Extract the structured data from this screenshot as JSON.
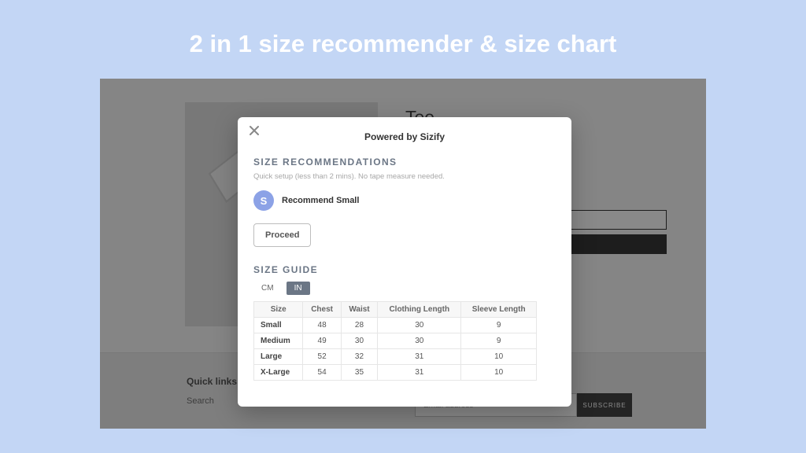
{
  "hero": {
    "title": "2 in 1 size recommender & size chart"
  },
  "product": {
    "title": "Tee"
  },
  "footer": {
    "quick_links_label": "Quick links",
    "search_label": "Search",
    "email_placeholder": "Email address",
    "subscribe_label": "SUBSCRIBE"
  },
  "modal": {
    "powered_by": "Powered by Sizify",
    "recommend_heading": "SIZE RECOMMENDATIONS",
    "recommend_sub": "Quick setup (less than 2 mins). No tape measure needed.",
    "badge_letter": "S",
    "recommend_text": "Recommend Small",
    "proceed_label": "Proceed",
    "guide_heading": "SIZE GUIDE",
    "unit_cm": "CM",
    "unit_in": "IN",
    "active_unit": "IN",
    "table": {
      "headers": [
        "Size",
        "Chest",
        "Waist",
        "Clothing Length",
        "Sleeve Length"
      ],
      "rows": [
        {
          "size": "Small",
          "chest": 48,
          "waist": 28,
          "clothing_length": 30,
          "sleeve_length": 9
        },
        {
          "size": "Medium",
          "chest": 49,
          "waist": 30,
          "clothing_length": 30,
          "sleeve_length": 9
        },
        {
          "size": "Large",
          "chest": 52,
          "waist": 32,
          "clothing_length": 31,
          "sleeve_length": 10
        },
        {
          "size": "X-Large",
          "chest": 54,
          "waist": 35,
          "clothing_length": 31,
          "sleeve_length": 10
        }
      ]
    }
  }
}
